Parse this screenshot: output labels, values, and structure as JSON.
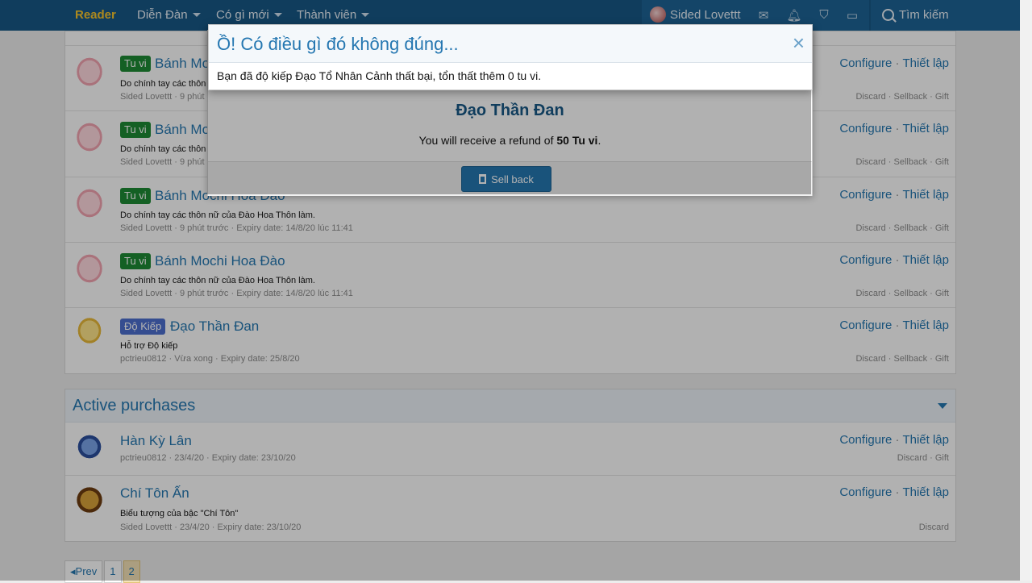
{
  "nav": {
    "brand": "Reader",
    "items": [
      {
        "label": "Diễn Đàn"
      },
      {
        "label": "Có gì mới"
      },
      {
        "label": "Thành viên"
      }
    ],
    "user": "Sided Lovettt",
    "search": "Tìm kiếm"
  },
  "rows": [
    {
      "badge": "Tu vi",
      "title": "Bánh Mo",
      "desc": "Do chính tay các thôn",
      "meta": "Sided Lovettt · 9 phút",
      "actions": {
        "configure": "Configure",
        "setup": "Thiết lập"
      },
      "sub": {
        "discard": "Discard",
        "sellback": "Sellback",
        "gift": "Gift"
      }
    },
    {
      "badge": "Tu vi",
      "title": "Bánh Mo",
      "desc": "Do chính tay các thôn",
      "meta": "Sided Lovettt · 9 phút",
      "actions": {
        "configure": "Configure",
        "setup": "Thiết lập"
      },
      "sub": {
        "discard": "Discard",
        "sellback": "Sellback",
        "gift": "Gift"
      }
    },
    {
      "badge": "Tu vi",
      "title": "Bánh Mochi Hoa Đào",
      "desc": "Do chính tay các thôn nữ của Đào Hoa Thôn làm.",
      "meta": "Sided Lovettt · 9 phút trước · Expiry date: 14/8/20 lúc 11:41",
      "actions": {
        "configure": "Configure",
        "setup": "Thiết lập"
      },
      "sub": {
        "discard": "Discard",
        "sellback": "Sellback",
        "gift": "Gift"
      }
    },
    {
      "badge": "Tu vi",
      "title": "Bánh Mochi Hoa Đào",
      "desc": "Do chính tay các thôn nữ của Đào Hoa Thôn làm.",
      "meta": "Sided Lovettt · 9 phút trước · Expiry date: 14/8/20 lúc 11:41",
      "actions": {
        "configure": "Configure",
        "setup": "Thiết lập"
      },
      "sub": {
        "discard": "Discard",
        "sellback": "Sellback",
        "gift": "Gift"
      }
    },
    {
      "badge": "Độ Kiếp",
      "title": "Đạo Thần Đan",
      "desc": "Hỗ trợ Độ kiếp",
      "meta": "pctrieu0812 · Vừa xong · Expiry date: 25/8/20",
      "actions": {
        "configure": "Configure",
        "setup": "Thiết lập"
      },
      "sub": {
        "discard": "Discard",
        "sellback": "Sellback",
        "gift": "Gift"
      }
    }
  ],
  "active": {
    "title": "Active purchases",
    "items": [
      {
        "title": "Hàn Kỳ Lân",
        "meta": "pctrieu0812 · 23/4/20 · Expiry date: 23/10/20",
        "actions": {
          "configure": "Configure",
          "setup": "Thiết lập"
        },
        "sub": {
          "discard": "Discard",
          "gift": "Gift"
        }
      },
      {
        "title": "Chí Tôn Ấn",
        "desc": "Biểu tượng của bậc \"Chí Tôn\"",
        "meta": "Sided Lovettt · 23/4/20 · Expiry date: 23/10/20",
        "actions": {
          "configure": "Configure",
          "setup": "Thiết lập"
        },
        "sub": {
          "discard": "Discard"
        }
      }
    ]
  },
  "pager": {
    "prev": "Prev",
    "pages": [
      "1",
      "2"
    ]
  },
  "sellback_modal": {
    "title": "Đạo Thần Đan",
    "text_prefix": "You will receive a refund of ",
    "amount": "50 Tu vi",
    "text_suffix": ".",
    "button": "Sell back"
  },
  "error_modal": {
    "title": "Ồ! Có điều gì đó không đúng...",
    "close": "×",
    "message": "Bạn đã độ kiếp Đạo Tổ Nhân Cảnh thất bại, tổn thất thêm 0 tu vi."
  },
  "colors": {
    "nav": "#185886",
    "accent": "#2577b1",
    "tuvi_badge": "#1e8a34",
    "dokiep_badge": "#4d6fcf"
  }
}
